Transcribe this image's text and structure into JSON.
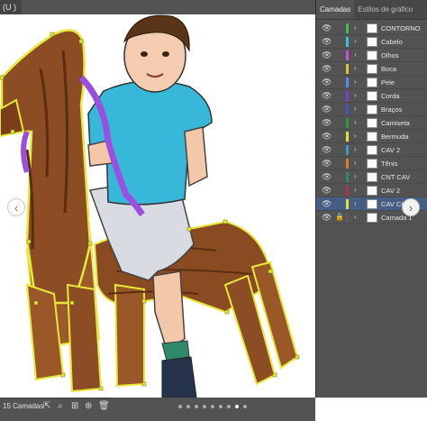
{
  "document_tab": {
    "label": "(U )"
  },
  "panel": {
    "tabs": [
      {
        "label": "Camadas",
        "active": true
      },
      {
        "label": "Estilos de gráfico",
        "active": false
      }
    ],
    "layers": [
      {
        "name": "CONTORNO",
        "color": "#3fc04a",
        "locked": false,
        "selected": false
      },
      {
        "name": "Cabelo",
        "color": "#38c2e0",
        "locked": false,
        "selected": false
      },
      {
        "name": "Olhos",
        "color": "#d04fe0",
        "locked": false,
        "selected": false
      },
      {
        "name": "Boca",
        "color": "#e0c43c",
        "locked": false,
        "selected": false
      },
      {
        "name": "Pele",
        "color": "#4e8fe0",
        "locked": false,
        "selected": false
      },
      {
        "name": "Corda",
        "color": "#7a3fd0",
        "locked": false,
        "selected": false
      },
      {
        "name": "Braços",
        "color": "#3e56c8",
        "locked": false,
        "selected": false
      },
      {
        "name": "Camiseta",
        "color": "#2e9a38",
        "locked": false,
        "selected": false
      },
      {
        "name": "Bermuda",
        "color": "#e8df3a",
        "locked": false,
        "selected": false
      },
      {
        "name": "CAV 2",
        "color": "#3a9ad0",
        "locked": false,
        "selected": false
      },
      {
        "name": "Tênis",
        "color": "#e07a2a",
        "locked": false,
        "selected": false
      },
      {
        "name": "CNT CAV",
        "color": "#2f8a6a",
        "locked": false,
        "selected": false
      },
      {
        "name": "CAV 2",
        "color": "#b8305a",
        "locked": false,
        "selected": false
      },
      {
        "name": "CAV CO",
        "color": "#e6e03a",
        "locked": false,
        "selected": true
      },
      {
        "name": "Camada 1",
        "color": "#5a5a5a",
        "locked": true,
        "selected": false
      }
    ],
    "footer": {
      "count": "15 Camadas"
    }
  },
  "carousel": {
    "dots": 9,
    "active_dot": 7
  },
  "icons": {
    "eye": "eye-icon",
    "lock": "lock-icon",
    "chevron": "chevron-right-icon",
    "prev": "chevron-left-icon",
    "next": "chevron-right-icon",
    "export": "export-icon",
    "search": "search-icon",
    "layer-new": "new-layer-icon",
    "sublayer": "sublayer-icon",
    "delete": "trash-icon"
  }
}
